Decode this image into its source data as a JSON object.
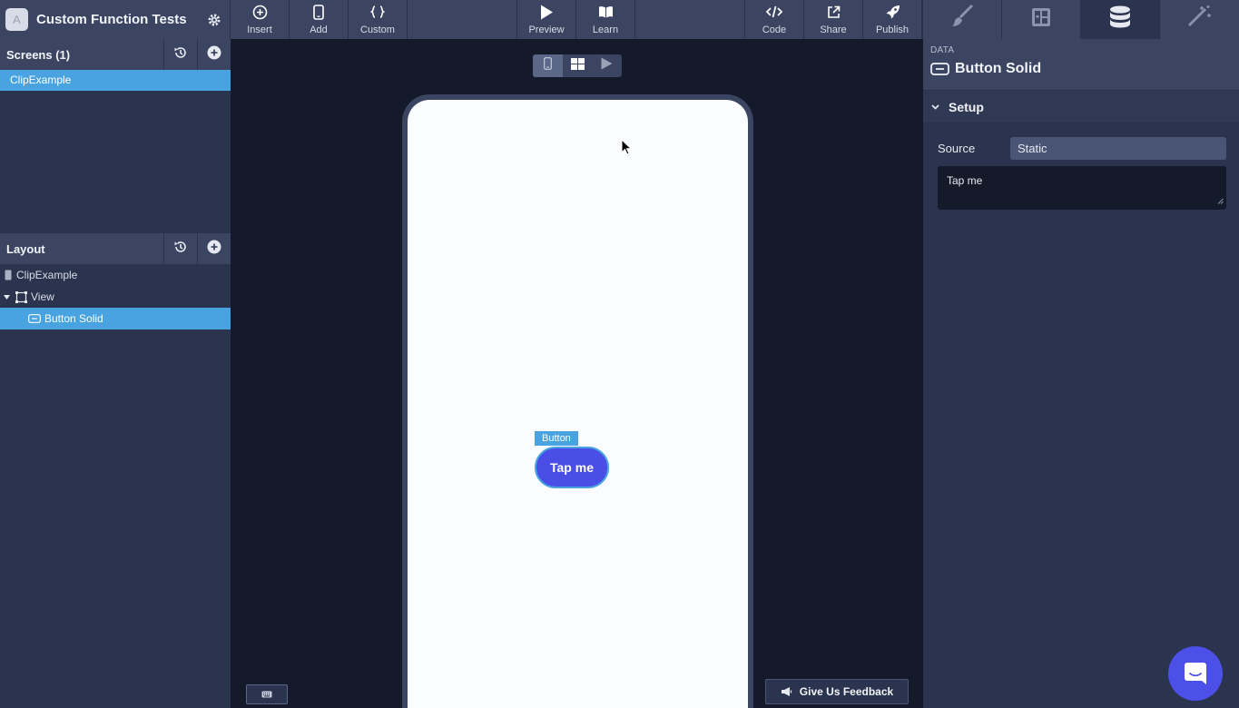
{
  "app": {
    "title": "Custom Function Tests",
    "logo_letter": "A"
  },
  "toolbar": {
    "insert": "Insert",
    "add": "Add",
    "custom": "Custom",
    "preview": "Preview",
    "learn": "Learn",
    "code": "Code",
    "share": "Share",
    "publish": "Publish"
  },
  "right_tabs": [
    "brush-icon",
    "layout-icon",
    "database-icon",
    "magic-wand-icon"
  ],
  "screens": {
    "title": "Screens (1)",
    "items": [
      "ClipExample"
    ]
  },
  "layout": {
    "title": "Layout",
    "tree": [
      {
        "label": "ClipExample",
        "icon": "phone-icon"
      },
      {
        "label": "View",
        "icon": "view-box-icon"
      },
      {
        "label": "Button Solid",
        "icon": "button-icon"
      }
    ]
  },
  "canvas": {
    "component_tag": "Button",
    "button_label": "Tap me",
    "feedback_label": "Give Us Feedback"
  },
  "inspector": {
    "kicker": "DATA",
    "title": "Button Solid",
    "section": "Setup",
    "source_label": "Source",
    "source_value": "Static",
    "text_value": "Tap me"
  },
  "colors": {
    "accent": "#48a3e0",
    "button": "#4a4ee6",
    "chat": "#4c4fe8"
  }
}
